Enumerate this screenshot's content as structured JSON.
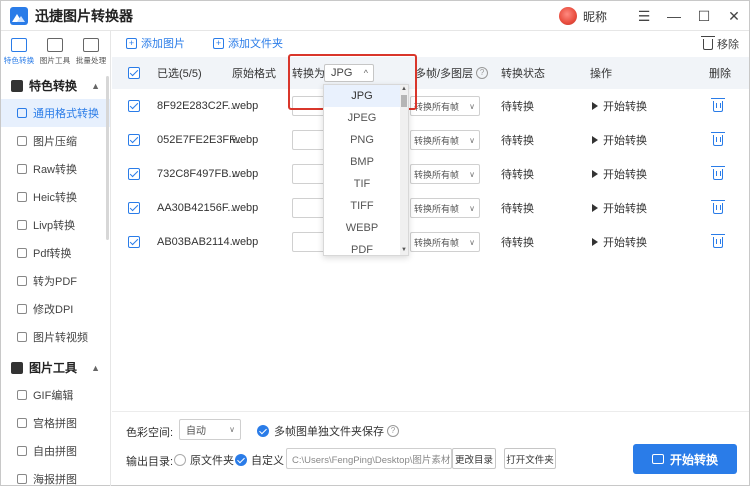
{
  "app": {
    "title": "迅捷图片转换器",
    "nickname": "昵称"
  },
  "window_controls": {
    "menu": "☰",
    "minimize": "—",
    "maximize": "☐",
    "close": "✕"
  },
  "tool_tabs": [
    {
      "label": "特色转换",
      "icon": "convert-icon",
      "active": true
    },
    {
      "label": "图片工具",
      "icon": "image-tools-icon",
      "active": false
    },
    {
      "label": "批量处理",
      "icon": "batch-icon",
      "active": false
    }
  ],
  "sidebar": {
    "section1": {
      "title": "特色转换"
    },
    "items1": [
      {
        "label": "通用格式转换",
        "active": true
      },
      {
        "label": "图片压缩"
      },
      {
        "label": "Raw转换"
      },
      {
        "label": "Heic转换"
      },
      {
        "label": "Livp转换"
      },
      {
        "label": "Pdf转换"
      },
      {
        "label": "转为PDF"
      },
      {
        "label": "修改DPI"
      },
      {
        "label": "图片转视频"
      }
    ],
    "section2": {
      "title": "图片工具"
    },
    "items2": [
      {
        "label": "GIF编辑"
      },
      {
        "label": "宫格拼图"
      },
      {
        "label": "自由拼图"
      },
      {
        "label": "海报拼图"
      }
    ]
  },
  "toolbar": {
    "add_image": "添加图片",
    "add_folder": "添加文件夹",
    "remove": "移除"
  },
  "table": {
    "headers": {
      "selected": "已选(5/5)",
      "original_format": "原始格式",
      "convert_to": "转换为",
      "convert_value": "JPG",
      "frames": "多帧/多图层",
      "status": "转换状态",
      "action": "操作",
      "delete": "删除"
    },
    "rows": [
      {
        "name": "8F92E283C2F...",
        "format": "webp",
        "frames": "转换所有帧",
        "status": "待转换",
        "action": "开始转换"
      },
      {
        "name": "052E7FE2E3FF...",
        "format": "webp",
        "frames": "转换所有帧",
        "status": "待转换",
        "action": "开始转换"
      },
      {
        "name": "732C8F497FB...",
        "format": "webp",
        "frames": "转换所有帧",
        "status": "待转换",
        "action": "开始转换"
      },
      {
        "name": "AA30B42156F...",
        "format": "webp",
        "frames": "转换所有帧",
        "status": "待转换",
        "action": "开始转换"
      },
      {
        "name": "AB03BAB2114...",
        "format": "webp",
        "frames": "转换所有帧",
        "status": "待转换",
        "action": "开始转换"
      }
    ]
  },
  "dropdown": {
    "options": [
      "JPG",
      "JPEG",
      "PNG",
      "BMP",
      "TIF",
      "TIFF",
      "WEBP",
      "PDF"
    ],
    "selected": "JPG"
  },
  "bottom": {
    "color_space_label": "色彩空间:",
    "color_space_value": "自动",
    "save_separate_label": "多帧图单独文件夹保存",
    "output_label": "输出目录:",
    "original_folder": "原文件夹",
    "custom": "自定义",
    "path": "C:\\Users\\FengPing\\Desktop\\图片素材",
    "change_dir": "更改目录",
    "open_folder": "打开文件夹",
    "start": "开始转换"
  },
  "colors": {
    "accent": "#2a7ce8",
    "highlight": "#d9362b"
  }
}
